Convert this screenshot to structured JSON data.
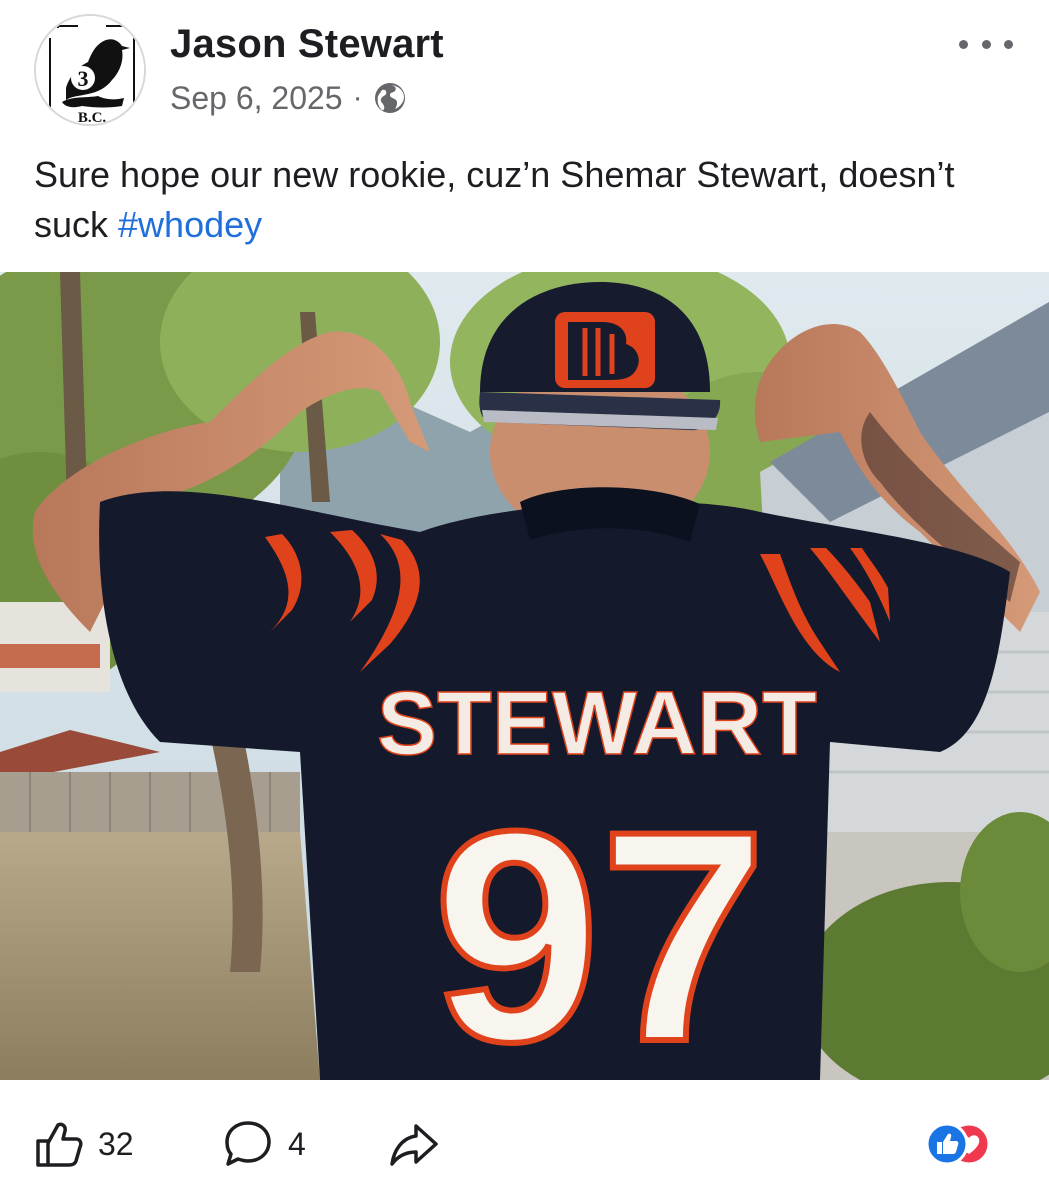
{
  "post": {
    "author": "Jason Stewart",
    "date": "Sep 6, 2025",
    "separator": "·",
    "privacy_icon": "globe-icon",
    "text_main": "Sure hope our new rookie, cuz’n Shemar Stewart, doesn’t suck ",
    "hashtag": "#whodey",
    "avatar_text": "B.C.",
    "avatar_number": "3"
  },
  "photo": {
    "jersey_name": "STEWART",
    "jersey_number": "97"
  },
  "actions": {
    "likes": "32",
    "comments": "4",
    "like_icon": "thumbs-up-icon",
    "comment_icon": "comment-icon",
    "share_icon": "share-icon",
    "reactions": [
      "like-reaction-icon",
      "love-reaction-icon"
    ]
  },
  "colors": {
    "text": "#1c1e21",
    "secondary": "#65676b",
    "link": "#216fdb",
    "like_blue": "#1b74e4",
    "love_red": "#f0384f",
    "jersey_navy": "#141a2c",
    "bengals_orange": "#e0431c"
  }
}
